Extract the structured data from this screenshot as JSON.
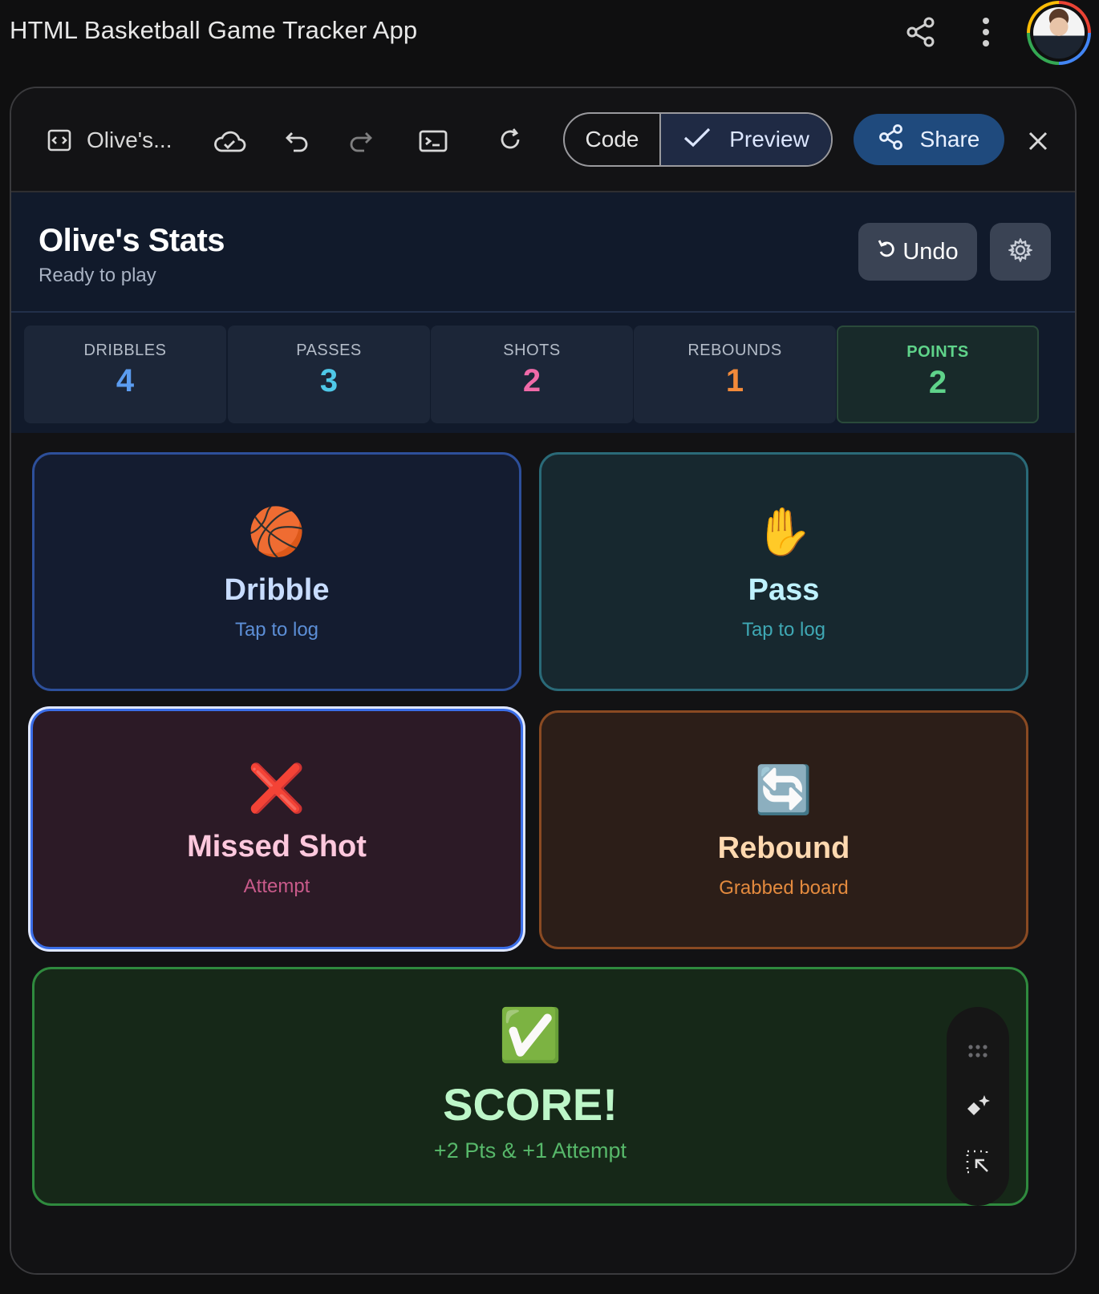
{
  "appbar": {
    "title": "HTML Basketball Game Tracker App",
    "share_icon": "share-icon",
    "more_icon": "more-vertical-icon"
  },
  "toolbar": {
    "file_name": "Olive's...",
    "code_label": "Code",
    "preview_label": "Preview",
    "share_label": "Share"
  },
  "tracker": {
    "title": "Olive's Stats",
    "status": "Ready to play",
    "undo_label": "Undo",
    "stats": [
      {
        "label": "DRIBBLES",
        "value": "4",
        "color": "#5b9cf0"
      },
      {
        "label": "PASSES",
        "value": "3",
        "color": "#4fc8e8"
      },
      {
        "label": "SHOTS",
        "value": "2",
        "color": "#f06aa8"
      },
      {
        "label": "REBOUNDS",
        "value": "1",
        "color": "#f28a3a"
      },
      {
        "label": "POINTS",
        "value": "2",
        "color": "#5fd38a"
      }
    ],
    "actions": {
      "dribble": {
        "emoji": "🏀",
        "title": "Dribble",
        "sub": "Tap to log"
      },
      "pass": {
        "emoji": "✋",
        "title": "Pass",
        "sub": "Tap to log"
      },
      "missed": {
        "emoji": "❌",
        "title": "Missed Shot",
        "sub": "Attempt"
      },
      "rebound": {
        "emoji": "🔄",
        "title": "Rebound",
        "sub": "Grabbed board"
      },
      "score": {
        "emoji": "✅",
        "title": "SCORE!",
        "sub": "+2 Pts & +1 Attempt"
      }
    }
  },
  "colors": {
    "accent": "#1f4a7d",
    "panel_bg": "#111a2b"
  }
}
